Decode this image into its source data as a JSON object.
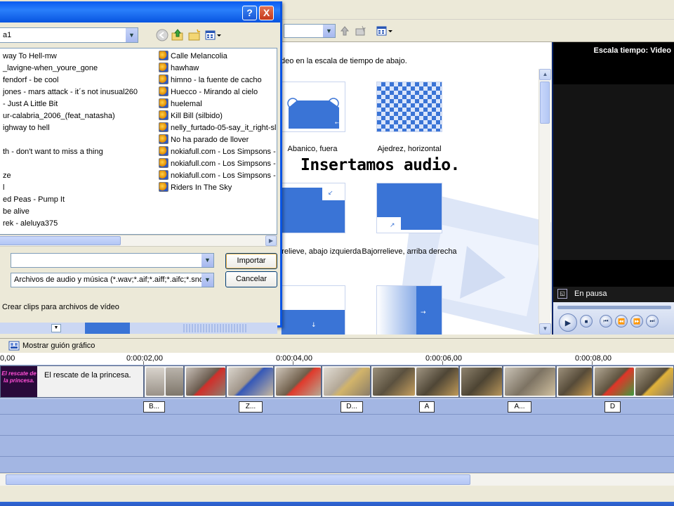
{
  "dialog": {
    "look_in_value": "a1",
    "files_col1": [
      "way To Hell-mw",
      "_lavigne-when_youre_gone",
      "fendorf - be cool",
      "jones - mars attack - it´s not inusual260",
      "- Just A Little Bit",
      "ur-calabria_2006_(feat_natasha)",
      "ighway to hell",
      "",
      "th - don't want to miss a thing",
      "",
      "ze",
      "l",
      "ed Peas - Pump It",
      "be alive",
      "rek - aleluya375"
    ],
    "files_col2": [
      "Calle Melancolia",
      "hawhaw",
      "himno - la fuente de cacho",
      "Huecco - Mirando al cielo",
      "huelemal",
      "Kill Bill (silbido)",
      "nelly_furtado-05-say_it_right-sl",
      "No ha parado de llover",
      "nokiafull.com - Los Simpsons - A",
      "nokiafull.com - Los Simpsons - B",
      "nokiafull.com - Los Simpsons - T",
      "Riders In The Sky"
    ],
    "filename_value": "",
    "filetype_value": "Archivos de audio y música (*.wav;*.aif;*.aiff;*.aifc;*.snd;*",
    "import_label": "Importar",
    "cancel_label": "Cancelar",
    "clips_checkbox_label": "Crear clips para archivos de vídeo",
    "help_glyph": "?",
    "close_glyph": "X"
  },
  "collection": {
    "instruction": "deo en la escala de tiempo de abajo.",
    "transitions": [
      {
        "label": "Abanico, fuera"
      },
      {
        "label": "Ajedrez, horizontal"
      },
      {
        "label": "Bajorrelieve, abajo izquierda"
      },
      {
        "label": "Bajorrelieve, arriba derecha"
      }
    ]
  },
  "caption": "Insertamos audio.",
  "monitor": {
    "title": "Escala tiempo: Video",
    "status": "En pausa"
  },
  "timeline": {
    "storyboard_label": "Mostrar guión gráfico",
    "ruler": [
      "0,00",
      "0:00:02,00",
      "0:00:04,00",
      "0:00:06,00",
      "0:00:08,00"
    ],
    "title_clip_thumb": "El rescate de la princesa.",
    "title_clip_text": "El rescate de la princesa.",
    "transition_markers": [
      "B...",
      "Z...",
      "D...",
      "A",
      "A...",
      "D"
    ]
  },
  "colors": {
    "xp_blue": "#0854e3",
    "track_blue": "#a3b6e3",
    "transition_blue": "#3a74d6"
  }
}
